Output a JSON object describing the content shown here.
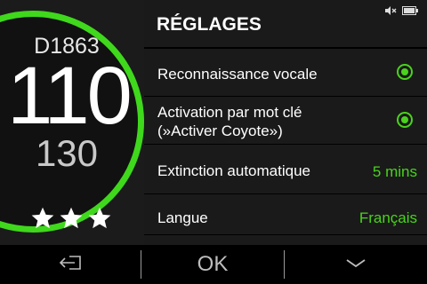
{
  "speed_panel": {
    "road_id": "D1863",
    "current_speed": "110",
    "speed_limit": "130",
    "stars": 3,
    "ring_color": "#3fd81c"
  },
  "status_bar": {
    "icons": [
      "speaker-muted-icon",
      "battery-icon"
    ]
  },
  "settings": {
    "title": "RÉGLAGES",
    "items": [
      {
        "label": "Reconnaissance vocale",
        "type": "toggle",
        "on": true
      },
      {
        "label_line1": "Activation par mot clé",
        "label_line2": "(»Activer Coyote»)",
        "type": "toggle",
        "on": true
      },
      {
        "label": "Extinction automatique",
        "value": "5 mins"
      },
      {
        "label": "Langue",
        "value": "Français"
      }
    ],
    "accent_color": "#49d31c"
  },
  "bottom_bar": {
    "back_icon": "exit-icon",
    "ok_label": "OK",
    "down_icon": "chevron-down-icon"
  }
}
